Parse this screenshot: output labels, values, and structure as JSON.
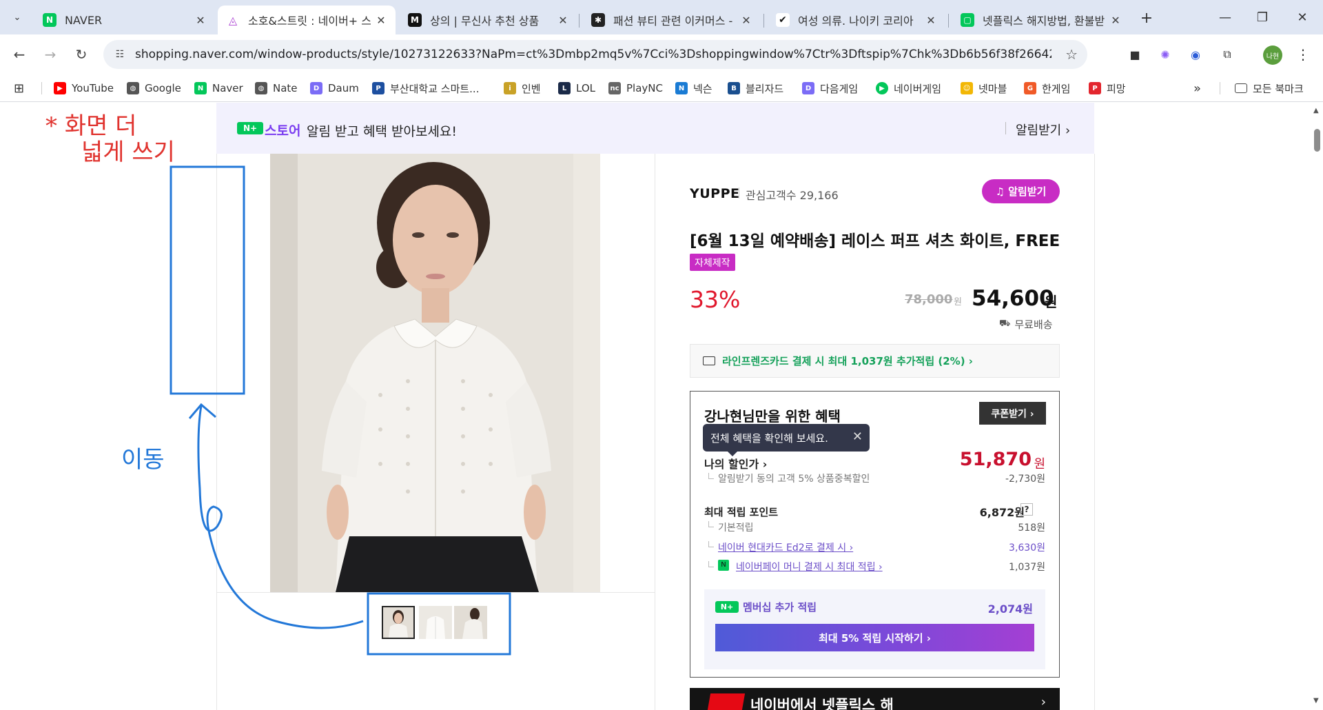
{
  "tabs": [
    {
      "title": "NAVER",
      "fav_color": "#03c75a",
      "fav_text": "N"
    },
    {
      "title": "소호&스트릿 : 네이버+ 스",
      "fav_color": "#ffffff",
      "fav_text": "◬"
    },
    {
      "title": "상의 | 무신사 추천 상품",
      "fav_color": "#111111",
      "fav_text": "M"
    },
    {
      "title": "패션 뷰티 관련 이커머스 - ",
      "fav_color": "#222222",
      "fav_text": "✱"
    },
    {
      "title": "여성 의류. 나이키 코리아",
      "fav_color": "#ffffff",
      "fav_text": "✔"
    },
    {
      "title": "넷플릭스 해지방법, 환불받",
      "fav_color": "#03c75a",
      "fav_text": "▢"
    }
  ],
  "tab_close_glyph": "✕",
  "newtab_glyph": "+",
  "window": {
    "minimize": "—",
    "restore": "❐",
    "close": "✕"
  },
  "toolbar": {
    "url": "shopping.naver.com/window-products/style/10273122633?NaPm=ct%3Dmbp2mq5v%7Cci%3Dshoppingwindow%7Ctr%3Dftspip%7Chk%3Db6b56f38f266424e0b0b07538...",
    "profile_text": "나현"
  },
  "bookmarks": [
    {
      "label": "YouTube",
      "color": "#ff0000",
      "text": "▶"
    },
    {
      "label": "Google",
      "color": "#555555",
      "text": "◍"
    },
    {
      "label": "Naver",
      "color": "#03c75a",
      "text": "N"
    },
    {
      "label": "Nate",
      "color": "#555555",
      "text": "◍"
    },
    {
      "label": "Daum",
      "color": "#7b6cf6",
      "text": "D"
    },
    {
      "label": "부산대학교 스마트...",
      "color": "#1d4fa0",
      "text": "P"
    },
    {
      "label": "인벤",
      "color": "#c9a227",
      "text": "i"
    },
    {
      "label": "LOL",
      "color": "#1b2a48",
      "text": "L"
    },
    {
      "label": "PlayNC",
      "color": "#666666",
      "text": "nc"
    },
    {
      "label": "넥슨",
      "color": "#1a7bd4",
      "text": "N"
    },
    {
      "label": "블리자드",
      "color": "#1a4f8f",
      "text": "B"
    },
    {
      "label": "다음게임",
      "color": "#7b6cf6",
      "text": "D"
    },
    {
      "label": "네이버게임",
      "color": "#03c75a",
      "text": "▶"
    },
    {
      "label": "넷마블",
      "color": "#f2b705",
      "text": "☺"
    },
    {
      "label": "한게임",
      "color": "#f05a28",
      "text": "G"
    },
    {
      "label": "피망",
      "color": "#e3262e",
      "text": "P"
    }
  ],
  "bookmarks_more": "»",
  "bookmarks_all": "모든 북마크",
  "page": {
    "banner": {
      "badge": "N+",
      "store": "스토어",
      "message": "알림 받고 혜택 받아보세요!",
      "action": "알림받기 ›"
    },
    "product": {
      "brand": "YUPPE",
      "interest": "관심고객수 29,166",
      "notify": "알림받기",
      "title": "[6월 13일 예약배송] 레이스 퍼프 셔츠 화이트, FREE",
      "tag": "자체제작",
      "discount": "33%",
      "original_price": "78,000",
      "original_won": "원",
      "price": "54,600",
      "price_won": "원",
      "shipping": "무료배송",
      "card_offer": "라인프렌즈카드 결제 시 최대 1,037원 추가적립 (2%) ›"
    },
    "benefit": {
      "title": "강나현님만을 위한 혜택",
      "coupon": "쿠폰받기 ›",
      "tooltip": "전체 혜택을 확인해 보세요.",
      "my_discount_label": "나의 할인가 ›",
      "my_discount_value": "51,870",
      "my_discount_won": "원",
      "sub_discount_label": "알림받기 동의 고객 5% 상품중복할인",
      "sub_discount_value": "-2,730원",
      "points_label": "최대 적립 포인트",
      "points_value": "6,872원",
      "points_help": "?",
      "rows": [
        {
          "label": "기본적립",
          "value": "518원"
        },
        {
          "label": "네이버 현대카드 Ed2로 결제 시 ›",
          "value": "3,630원"
        },
        {
          "label": "네이버페이 머니 결제 시 최대 적립 ›",
          "value": "1,037원"
        }
      ],
      "membership": {
        "badge": "N+",
        "label": "멤버십 추가 적립",
        "value": "2,074원",
        "button": "최대 5% 적립 시작하기 ›"
      }
    },
    "netflix_banner": "네이버에서 넷플릭스 해",
    "netflix_arrow": "›"
  },
  "annotations": {
    "top_note_line1": "* 화면 더",
    "top_note_line2": "넓게 쓰기",
    "move_note": "이동"
  },
  "colors": {
    "accent_magenta": "#c82cc4",
    "sale_red": "#e0172c",
    "naver_green": "#03c75a",
    "purple": "#6b4ec8",
    "annot_blue": "#2378d8",
    "annot_red": "#e0332e"
  }
}
